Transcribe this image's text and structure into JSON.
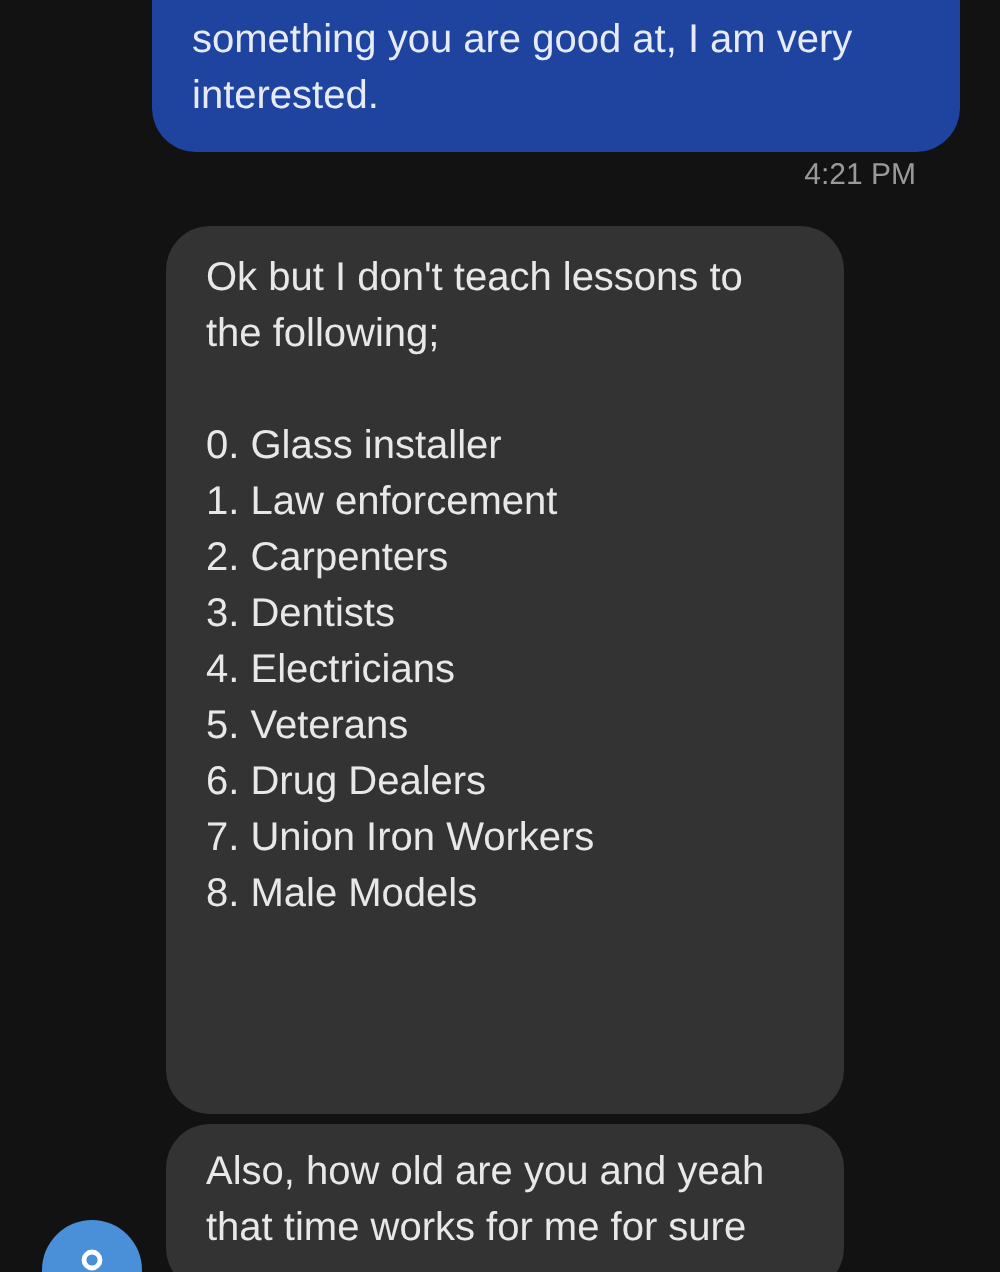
{
  "messages": [
    {
      "kind": "sent",
      "text": "something you are good at, I am very interested."
    },
    {
      "kind": "time",
      "text": "4:21 PM"
    },
    {
      "kind": "received",
      "text": "Ok but I don't teach lessons to the following;",
      "list": [
        "0. Glass installer",
        "1. Law enforcement",
        "2. Carpenters",
        "3. Dentists",
        "4. Electricians",
        "5. Veterans",
        "6. Drug Dealers",
        "7. Union Iron Workers",
        "8. Male Models"
      ]
    },
    {
      "kind": "received",
      "avatar": true,
      "text": "Also, how old are you and yeah that time works for me for sure"
    }
  ]
}
